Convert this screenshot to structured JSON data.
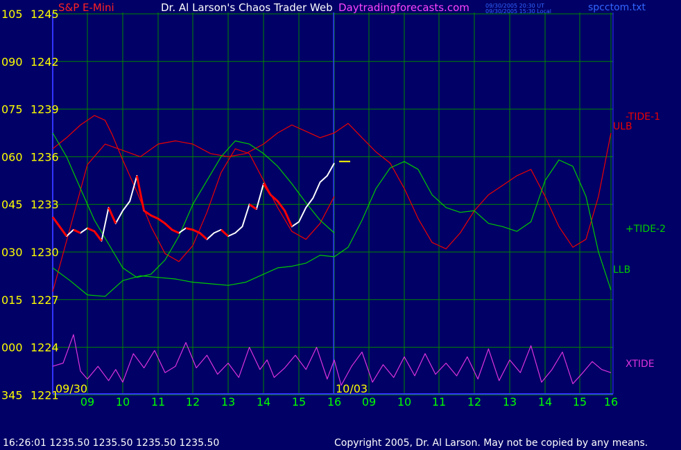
{
  "header": {
    "instrument": "S&P E-Mini",
    "title": "Dr. Al Larson's Chaos Trader Web",
    "site": "Daytradingforecasts.com",
    "time_utc": "09/30/2005 20:30 UT",
    "time_local": "09/30/2005 15:30 Local",
    "filename": "spcctom.txt"
  },
  "footer": {
    "quote": "16:26:01  1235.50 1235.50 1235.50 1235.50",
    "copyright": "Copyright 2005, Dr. Al Larson. May not be copied by any means."
  },
  "colors": {
    "background": "#000066",
    "grid": "#008800",
    "axis": "#3333ff",
    "price_up": "#ffffff",
    "price_down": "#ff0000",
    "green_line": "#00cc00",
    "red_line": "#ee0000",
    "xtide": "#dd33dd",
    "yellow": "#ffff00"
  },
  "chart_data": {
    "type": "line",
    "y_left_labels": [
      "105",
      "090",
      "075",
      "060",
      "045",
      "030",
      "015",
      "000",
      "345"
    ],
    "y_price_labels": [
      "1245",
      "1242",
      "1239",
      "1236",
      "1233",
      "1230",
      "1227",
      "1224",
      "1221"
    ],
    "ylim": [
      1221,
      1245
    ],
    "x_tick_labels": [
      "09",
      "10",
      "11",
      "12",
      "13",
      "14",
      "15",
      "16",
      "09",
      "10",
      "11",
      "12",
      "13",
      "14",
      "15",
      "16"
    ],
    "date_labels": [
      "09/30",
      "10/03"
    ],
    "series": [
      {
        "name": "-TIDE-1",
        "color": "#ee0000",
        "x": [
          0,
          0.4,
          0.8,
          1.2,
          1.5,
          1.7,
          2,
          2.4,
          2.8,
          3.2,
          3.6,
          4,
          4.4,
          4.8,
          5.2,
          5.6,
          6,
          6.4,
          6.8,
          7.2,
          7.6,
          8
        ],
        "y": [
          1236.5,
          1237.2,
          1238,
          1238.6,
          1238.3,
          1237.4,
          1235.8,
          1233.8,
          1231.6,
          1229.9,
          1229.4,
          1230.4,
          1232.5,
          1235.0,
          1236.5,
          1236.2,
          1234.5,
          1232.8,
          1231.3,
          1230.8,
          1231.8,
          1233.5
        ]
      },
      {
        "name": "ULB",
        "color": "#ee0000",
        "x": [
          0,
          0.5,
          1,
          1.5,
          2,
          2.5,
          3,
          3.5,
          4,
          4.5,
          5,
          5.5,
          6,
          6.4,
          6.8,
          7.2,
          7.6,
          8,
          8.4,
          8.8,
          9.2,
          9.6,
          10,
          10.4,
          10.8,
          11.2,
          11.6,
          12,
          12.4,
          12.8,
          13.2,
          13.6,
          14,
          14.4,
          14.8,
          15.2,
          15.6,
          16
        ],
        "y": [
          1227.5,
          1231.5,
          1235.5,
          1236.8,
          1236.4,
          1236,
          1236.8,
          1237,
          1236.8,
          1236.2,
          1236,
          1236.2,
          1236.8,
          1237.5,
          1238,
          1237.6,
          1237.2,
          1237.5,
          1238.1,
          1237.2,
          1236.3,
          1235.6,
          1234,
          1232.1,
          1230.6,
          1230.2,
          1231.2,
          1232.6,
          1233.6,
          1234.2,
          1234.8,
          1235.2,
          1233.5,
          1231.6,
          1230.3,
          1230.8,
          1233.5,
          1237.5
        ]
      },
      {
        "name": "+TIDE-2",
        "color": "#00cc00",
        "x": [
          0,
          0.4,
          0.8,
          1.2,
          1.6,
          2,
          2.4,
          2.8,
          3.2,
          3.6,
          4,
          4.4,
          4.8,
          5.2,
          5.6,
          6,
          6.4,
          6.8,
          7.2,
          7.6,
          8
        ],
        "y": [
          1237.5,
          1236,
          1234,
          1232,
          1230.5,
          1229,
          1228.4,
          1228.6,
          1229.5,
          1231,
          1233,
          1234.5,
          1236,
          1237,
          1236.8,
          1236.2,
          1235.4,
          1234.3,
          1233.1,
          1232,
          1231.2
        ]
      },
      {
        "name": "LLB",
        "color": "#00cc00",
        "x": [
          0,
          0.5,
          1,
          1.5,
          2,
          2.5,
          3,
          3.5,
          4,
          4.5,
          5,
          5.5,
          6,
          6.4,
          6.8,
          7.2,
          7.6,
          8,
          8.4,
          8.8,
          9.2,
          9.6,
          10,
          10.4,
          10.8,
          11.2,
          11.6,
          12,
          12.4,
          12.8,
          13.2,
          13.6,
          14,
          14.4,
          14.8,
          15.2,
          15.6,
          16
        ],
        "y": [
          1229,
          1228.2,
          1227.3,
          1227.2,
          1228.2,
          1228.5,
          1228.4,
          1228.3,
          1228.1,
          1228,
          1227.9,
          1228.1,
          1228.6,
          1229,
          1229.1,
          1229.3,
          1229.8,
          1229.7,
          1230.3,
          1232,
          1234,
          1235.3,
          1235.7,
          1235.2,
          1233.6,
          1232.8,
          1232.5,
          1232.6,
          1231.8,
          1231.6,
          1231.3,
          1231.9,
          1234.5,
          1235.8,
          1235.4,
          1233.5,
          1230,
          1227.6
        ]
      },
      {
        "name": "XTIDE",
        "color": "#dd33dd",
        "x": [
          0,
          0.3,
          0.6,
          0.8,
          1,
          1.3,
          1.6,
          1.8,
          2,
          2.3,
          2.6,
          2.9,
          3.2,
          3.5,
          3.8,
          4.1,
          4.4,
          4.7,
          5,
          5.3,
          5.6,
          5.9,
          6.1,
          6.3,
          6.6,
          6.9,
          7.2,
          7.5,
          7.8,
          8,
          8.2,
          8.5,
          8.8,
          9.1,
          9.4,
          9.7,
          10,
          10.3,
          10.6,
          10.9,
          11.2,
          11.5,
          11.8,
          12.1,
          12.4,
          12.7,
          13,
          13.3,
          13.6,
          13.9,
          14.2,
          14.5,
          14.8,
          15.1,
          15.4,
          15.7,
          16
        ],
        "y": [
          1222.8,
          1223,
          1224.8,
          1222.5,
          1222,
          1222.8,
          1221.9,
          1222.6,
          1221.8,
          1223.6,
          1222.7,
          1223.8,
          1222.4,
          1222.8,
          1224.3,
          1222.7,
          1223.5,
          1222.3,
          1223,
          1222.1,
          1224,
          1222.6,
          1223.2,
          1222.1,
          1222.7,
          1223.5,
          1222.6,
          1224,
          1222,
          1223.2,
          1221.6,
          1222.8,
          1223.7,
          1221.8,
          1222.9,
          1222.1,
          1223.4,
          1222.2,
          1223.6,
          1222.3,
          1223,
          1222.2,
          1223.4,
          1222,
          1223.9,
          1221.9,
          1223.2,
          1222.4,
          1224.1,
          1221.8,
          1222.6,
          1223.7,
          1221.7,
          1222.4,
          1223.1,
          1222.6,
          1222.4
        ]
      },
      {
        "name": "S&P E-Mini",
        "color": "#ffffff",
        "x": [
          0,
          0.2,
          0.4,
          0.6,
          0.8,
          1,
          1.2,
          1.4,
          1.6,
          1.8,
          2,
          2.2,
          2.4,
          2.6,
          2.8,
          3,
          3.2,
          3.4,
          3.6,
          3.8,
          4,
          4.2,
          4.4,
          4.6,
          4.8,
          5,
          5.2,
          5.4,
          5.6,
          5.8,
          6,
          6.2,
          6.4,
          6.6,
          6.8,
          7,
          7.2,
          7.4,
          7.6,
          7.8,
          8
        ],
        "y": [
          1232.2,
          1231.6,
          1231,
          1231.4,
          1231.2,
          1231.5,
          1231.3,
          1230.7,
          1232.8,
          1231.8,
          1232.6,
          1233.2,
          1234.8,
          1232.6,
          1232.3,
          1232.1,
          1231.8,
          1231.4,
          1231.2,
          1231.5,
          1231.4,
          1231.2,
          1230.8,
          1231.2,
          1231.4,
          1231,
          1231.2,
          1231.6,
          1233,
          1232.7,
          1234.3,
          1233.6,
          1233.2,
          1232.6,
          1231.6,
          1231.9,
          1232.8,
          1233.4,
          1234.4,
          1234.8,
          1235.6
        ]
      }
    ],
    "price_marker": 1235.7,
    "annotations": [
      "-TIDE-1",
      "ULB",
      "+TIDE-2",
      "LLB",
      "XTIDE"
    ]
  }
}
